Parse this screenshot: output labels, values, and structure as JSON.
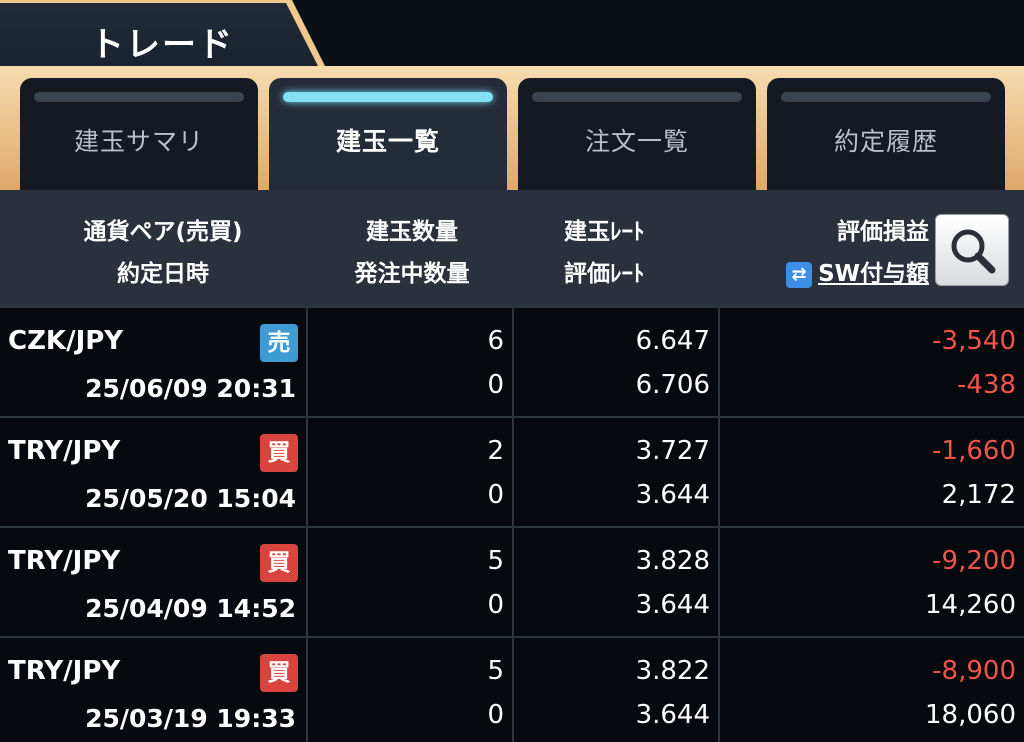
{
  "title_tab": {
    "label": "トレード"
  },
  "tabs": [
    {
      "label": "建玉サマリ",
      "active": false
    },
    {
      "label": "建玉一覧",
      "active": true
    },
    {
      "label": "注文一覧",
      "active": false
    },
    {
      "label": "約定履歴",
      "active": false
    }
  ],
  "header": {
    "col1_line1": "通貨ペア(売買)",
    "col1_line2": "約定日時",
    "col2_line1": "建玉数量",
    "col2_line2": "発注中数量",
    "col3_line1": "建玉ﾚｰﾄ",
    "col3_line2": "評価ﾚｰﾄ",
    "col4_line1": "評価損益",
    "col4_line2": "SW付与額"
  },
  "colors": {
    "sell": "#3e9bd3",
    "buy": "#d9443e",
    "negative": "#f0544c",
    "accent_gold": "#e8b878",
    "active_indicator": "#86e0f3"
  },
  "rows": [
    {
      "pair": "CZK/JPY",
      "side": "売",
      "side_type": "sell",
      "datetime": "25/06/09 20:31",
      "qty": "6",
      "pending_qty": "0",
      "rate": "6.647",
      "eval_rate": "6.706",
      "pnl": "-3,540",
      "pnl_negative": true,
      "swap": "-438",
      "swap_negative": true
    },
    {
      "pair": "TRY/JPY",
      "side": "買",
      "side_type": "buy",
      "datetime": "25/05/20 15:04",
      "qty": "2",
      "pending_qty": "0",
      "rate": "3.727",
      "eval_rate": "3.644",
      "pnl": "-1,660",
      "pnl_negative": true,
      "swap": "2,172",
      "swap_negative": false
    },
    {
      "pair": "TRY/JPY",
      "side": "買",
      "side_type": "buy",
      "datetime": "25/04/09 14:52",
      "qty": "5",
      "pending_qty": "0",
      "rate": "3.828",
      "eval_rate": "3.644",
      "pnl": "-9,200",
      "pnl_negative": true,
      "swap": "14,260",
      "swap_negative": false
    },
    {
      "pair": "TRY/JPY",
      "side": "買",
      "side_type": "buy",
      "datetime": "25/03/19 19:33",
      "qty": "5",
      "pending_qty": "0",
      "rate": "3.822",
      "eval_rate": "3.644",
      "pnl": "-8,900",
      "pnl_negative": true,
      "swap": "18,060",
      "swap_negative": false
    }
  ]
}
